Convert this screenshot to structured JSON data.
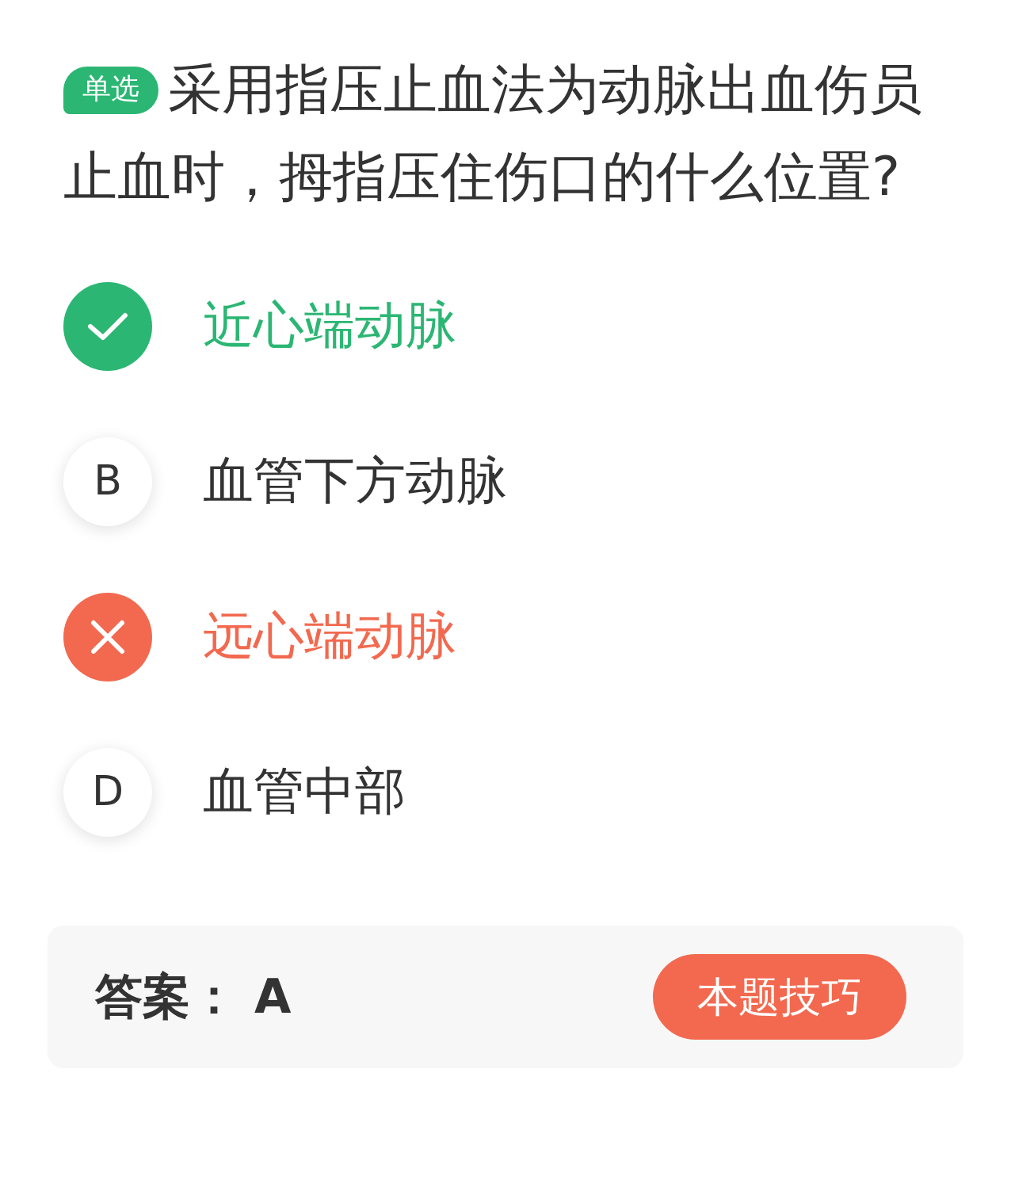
{
  "question": {
    "badge": "单选",
    "text": "采用指压止血法为动脉出血伤员止血时，拇指压住伤口的什么位置?"
  },
  "options": [
    {
      "kind": "correct",
      "text": "近心端动脉"
    },
    {
      "kind": "plain",
      "letter": "B",
      "text": "血管下方动脉"
    },
    {
      "kind": "wrong",
      "text": "远心端动脉"
    },
    {
      "kind": "plain",
      "letter": "D",
      "text": "血管中部"
    }
  ],
  "answer": {
    "label": "答案：",
    "value": "A",
    "button": "本题技巧"
  }
}
